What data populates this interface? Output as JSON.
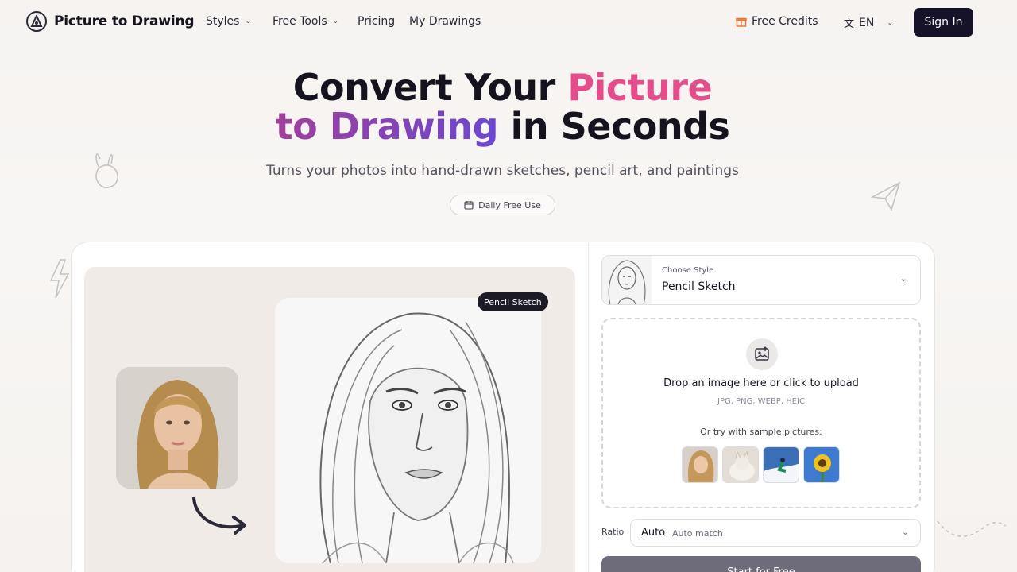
{
  "nav": {
    "brand": "Picture to Drawing",
    "items": [
      {
        "label": "Styles",
        "has_dropdown": true
      },
      {
        "label": "Free Tools",
        "has_dropdown": true
      },
      {
        "label": "Pricing",
        "has_dropdown": false
      },
      {
        "label": "My Drawings",
        "has_dropdown": false
      }
    ],
    "credits_label": "Free Credits",
    "language": "EN",
    "sign_in": "Sign In"
  },
  "hero": {
    "title_part1": "Convert Your ",
    "title_highlight1": "Picture",
    "title_highlight2": "to Drawing",
    "title_part2": " in Seconds",
    "subtitle": "Turns your photos into hand-drawn sketches, pencil art, and paintings",
    "badge": "Daily Free Use"
  },
  "demo": {
    "badge": "Pencil Sketch"
  },
  "style_picker": {
    "label": "Choose Style",
    "value": "Pencil Sketch"
  },
  "upload": {
    "title": "Drop an image here or click to upload",
    "formats": "JPG, PNG, WEBP, HEIC",
    "sample_label": "Or try with sample pictures:",
    "samples": [
      "woman-portrait",
      "cat",
      "skier",
      "sunflower"
    ]
  },
  "ratio": {
    "label": "Ratio",
    "value": "Auto",
    "sub": "Auto match"
  },
  "cta": "Start for Free",
  "colors": {
    "accent_pink": "#e64a8a",
    "accent_purple": "#6b46d2",
    "dark": "#15122a"
  }
}
